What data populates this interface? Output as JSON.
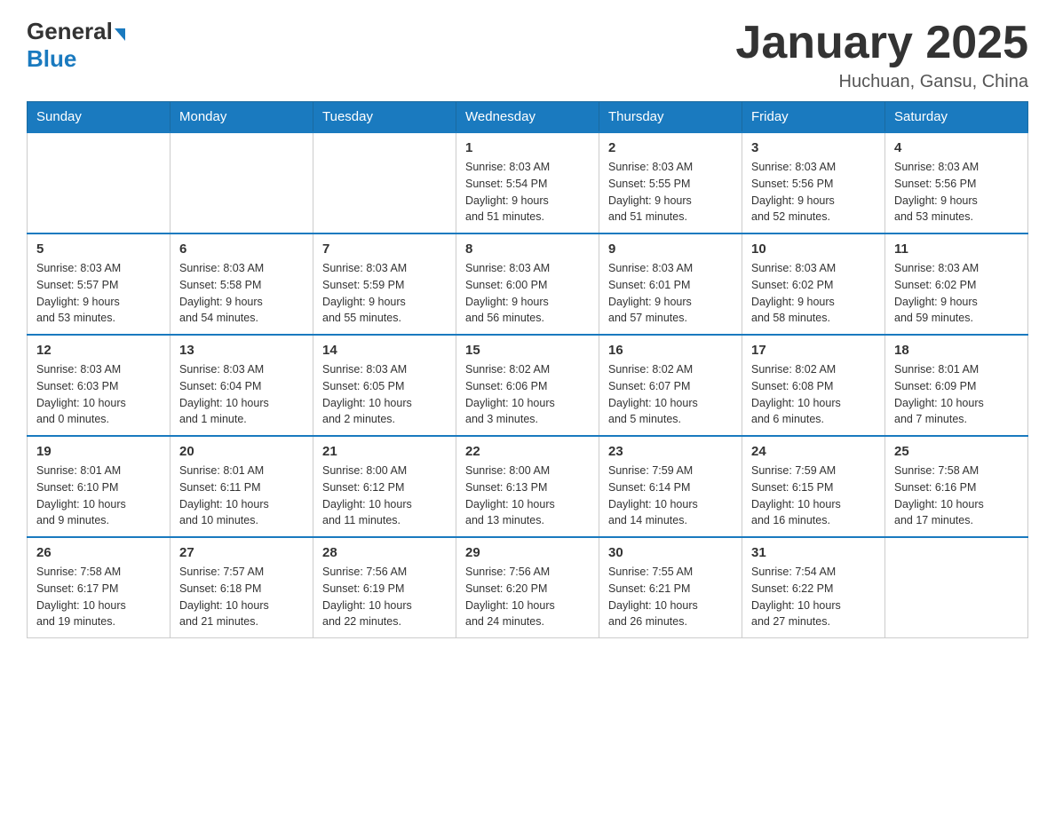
{
  "logo": {
    "general": "General",
    "blue": "Blue"
  },
  "title": "January 2025",
  "location": "Huchuan, Gansu, China",
  "days_of_week": [
    "Sunday",
    "Monday",
    "Tuesday",
    "Wednesday",
    "Thursday",
    "Friday",
    "Saturday"
  ],
  "weeks": [
    [
      {
        "day": "",
        "info": ""
      },
      {
        "day": "",
        "info": ""
      },
      {
        "day": "",
        "info": ""
      },
      {
        "day": "1",
        "info": "Sunrise: 8:03 AM\nSunset: 5:54 PM\nDaylight: 9 hours\nand 51 minutes."
      },
      {
        "day": "2",
        "info": "Sunrise: 8:03 AM\nSunset: 5:55 PM\nDaylight: 9 hours\nand 51 minutes."
      },
      {
        "day": "3",
        "info": "Sunrise: 8:03 AM\nSunset: 5:56 PM\nDaylight: 9 hours\nand 52 minutes."
      },
      {
        "day": "4",
        "info": "Sunrise: 8:03 AM\nSunset: 5:56 PM\nDaylight: 9 hours\nand 53 minutes."
      }
    ],
    [
      {
        "day": "5",
        "info": "Sunrise: 8:03 AM\nSunset: 5:57 PM\nDaylight: 9 hours\nand 53 minutes."
      },
      {
        "day": "6",
        "info": "Sunrise: 8:03 AM\nSunset: 5:58 PM\nDaylight: 9 hours\nand 54 minutes."
      },
      {
        "day": "7",
        "info": "Sunrise: 8:03 AM\nSunset: 5:59 PM\nDaylight: 9 hours\nand 55 minutes."
      },
      {
        "day": "8",
        "info": "Sunrise: 8:03 AM\nSunset: 6:00 PM\nDaylight: 9 hours\nand 56 minutes."
      },
      {
        "day": "9",
        "info": "Sunrise: 8:03 AM\nSunset: 6:01 PM\nDaylight: 9 hours\nand 57 minutes."
      },
      {
        "day": "10",
        "info": "Sunrise: 8:03 AM\nSunset: 6:02 PM\nDaylight: 9 hours\nand 58 minutes."
      },
      {
        "day": "11",
        "info": "Sunrise: 8:03 AM\nSunset: 6:02 PM\nDaylight: 9 hours\nand 59 minutes."
      }
    ],
    [
      {
        "day": "12",
        "info": "Sunrise: 8:03 AM\nSunset: 6:03 PM\nDaylight: 10 hours\nand 0 minutes."
      },
      {
        "day": "13",
        "info": "Sunrise: 8:03 AM\nSunset: 6:04 PM\nDaylight: 10 hours\nand 1 minute."
      },
      {
        "day": "14",
        "info": "Sunrise: 8:03 AM\nSunset: 6:05 PM\nDaylight: 10 hours\nand 2 minutes."
      },
      {
        "day": "15",
        "info": "Sunrise: 8:02 AM\nSunset: 6:06 PM\nDaylight: 10 hours\nand 3 minutes."
      },
      {
        "day": "16",
        "info": "Sunrise: 8:02 AM\nSunset: 6:07 PM\nDaylight: 10 hours\nand 5 minutes."
      },
      {
        "day": "17",
        "info": "Sunrise: 8:02 AM\nSunset: 6:08 PM\nDaylight: 10 hours\nand 6 minutes."
      },
      {
        "day": "18",
        "info": "Sunrise: 8:01 AM\nSunset: 6:09 PM\nDaylight: 10 hours\nand 7 minutes."
      }
    ],
    [
      {
        "day": "19",
        "info": "Sunrise: 8:01 AM\nSunset: 6:10 PM\nDaylight: 10 hours\nand 9 minutes."
      },
      {
        "day": "20",
        "info": "Sunrise: 8:01 AM\nSunset: 6:11 PM\nDaylight: 10 hours\nand 10 minutes."
      },
      {
        "day": "21",
        "info": "Sunrise: 8:00 AM\nSunset: 6:12 PM\nDaylight: 10 hours\nand 11 minutes."
      },
      {
        "day": "22",
        "info": "Sunrise: 8:00 AM\nSunset: 6:13 PM\nDaylight: 10 hours\nand 13 minutes."
      },
      {
        "day": "23",
        "info": "Sunrise: 7:59 AM\nSunset: 6:14 PM\nDaylight: 10 hours\nand 14 minutes."
      },
      {
        "day": "24",
        "info": "Sunrise: 7:59 AM\nSunset: 6:15 PM\nDaylight: 10 hours\nand 16 minutes."
      },
      {
        "day": "25",
        "info": "Sunrise: 7:58 AM\nSunset: 6:16 PM\nDaylight: 10 hours\nand 17 minutes."
      }
    ],
    [
      {
        "day": "26",
        "info": "Sunrise: 7:58 AM\nSunset: 6:17 PM\nDaylight: 10 hours\nand 19 minutes."
      },
      {
        "day": "27",
        "info": "Sunrise: 7:57 AM\nSunset: 6:18 PM\nDaylight: 10 hours\nand 21 minutes."
      },
      {
        "day": "28",
        "info": "Sunrise: 7:56 AM\nSunset: 6:19 PM\nDaylight: 10 hours\nand 22 minutes."
      },
      {
        "day": "29",
        "info": "Sunrise: 7:56 AM\nSunset: 6:20 PM\nDaylight: 10 hours\nand 24 minutes."
      },
      {
        "day": "30",
        "info": "Sunrise: 7:55 AM\nSunset: 6:21 PM\nDaylight: 10 hours\nand 26 minutes."
      },
      {
        "day": "31",
        "info": "Sunrise: 7:54 AM\nSunset: 6:22 PM\nDaylight: 10 hours\nand 27 minutes."
      },
      {
        "day": "",
        "info": ""
      }
    ]
  ]
}
